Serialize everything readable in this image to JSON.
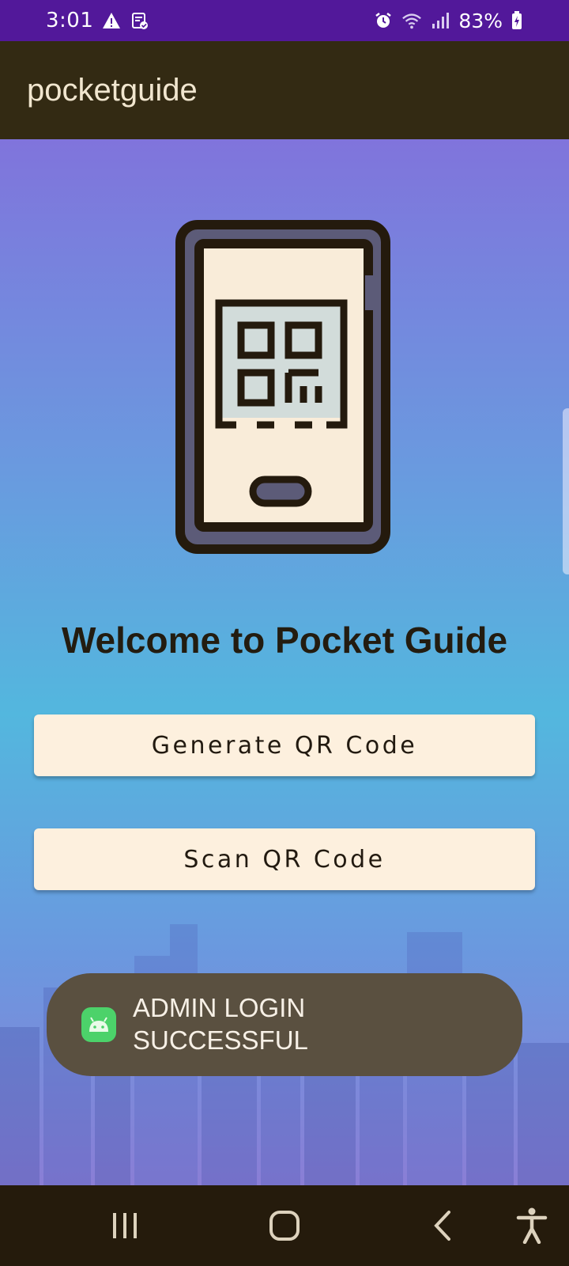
{
  "status_bar": {
    "time": "3:01",
    "battery_percent": "83%",
    "icons": [
      "warning-icon",
      "clipboard-check-icon",
      "alarm-icon",
      "wifi-icon",
      "signal-icon",
      "battery-charging-icon"
    ]
  },
  "app_bar": {
    "title": "pocketguide"
  },
  "main": {
    "illustration": "phone-with-qr-code",
    "welcome_text": "Welcome to Pocket Guide",
    "generate_button_label": "Generate QR Code",
    "scan_button_label": "Scan QR Code"
  },
  "toast": {
    "icon": "android-app-icon",
    "message": "ADMIN LOGIN\nSUCCESSFUL"
  },
  "nav_bar": {
    "icons": [
      "recents-icon",
      "home-icon",
      "back-icon",
      "accessibility-icon"
    ]
  },
  "colors": {
    "status_bar": "#52189a",
    "app_bar": "#332a13",
    "button_bg": "#fdf0de",
    "toast_bg": "#5a5040",
    "nav_bar": "#251b0c"
  }
}
